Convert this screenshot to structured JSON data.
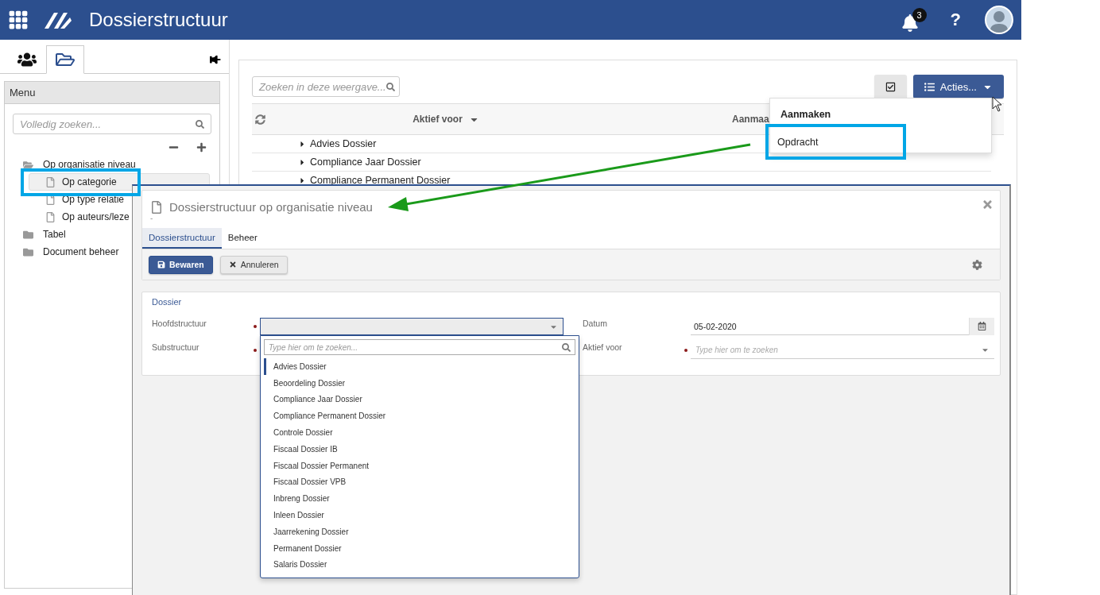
{
  "header": {
    "title": "Dossierstructuur",
    "notification_count": "3",
    "help": "?"
  },
  "sidebar": {
    "tabs": [
      {
        "kind": "people",
        "selected": false
      },
      {
        "kind": "folder",
        "selected": true
      }
    ],
    "menu_title": "Menu",
    "search_placeholder": "Volledig zoeken...",
    "tree": [
      {
        "label": "Op organisatie niveau",
        "expanded": true,
        "children": [
          {
            "label": "Op categorie",
            "selected": true
          },
          {
            "label": "Op type relatie",
            "selected": false
          },
          {
            "label": "Op auteurs/leze",
            "selected": false
          }
        ]
      },
      {
        "label": "Tabel",
        "expanded": false
      },
      {
        "label": "Document beheer",
        "expanded": false
      }
    ]
  },
  "view": {
    "search_placeholder": "Zoeken in deze weergave...",
    "actions_label": "Acties...",
    "columns": [
      {
        "label": "Aktief voor",
        "sorted": true
      },
      {
        "label": "Aanmaa"
      }
    ],
    "rows": [
      "Advies Dossier",
      "Compliance Jaar Dossier",
      "Compliance Permanent Dossier"
    ]
  },
  "actions_menu": {
    "header": "Aanmaken",
    "items": [
      "Opdracht"
    ]
  },
  "dialog": {
    "title": "Dossierstructuur op organisatie niveau",
    "subtitle": "-",
    "tabs": [
      {
        "label": "Dossierstructuur",
        "selected": true
      },
      {
        "label": "Beheer",
        "selected": false
      }
    ],
    "buttons": [
      {
        "label": "Bewaren",
        "kind": "primary"
      },
      {
        "label": "Annuleren",
        "kind": "secondary"
      }
    ],
    "section": "Dossier",
    "fields": [
      {
        "label": "Hoofdstructuur",
        "required": true,
        "kind": "select",
        "open": true
      },
      {
        "label": "Datum",
        "kind": "date",
        "value": "05-02-2020"
      },
      {
        "label": "Substructuur",
        "required": true,
        "kind": "hidden"
      },
      {
        "label": "Aktief voor",
        "required": true,
        "kind": "select",
        "open": false,
        "placeholder": "Type hier om te zoeken"
      }
    ],
    "dropdown": {
      "placeholder": "Type hier om te zoeken...",
      "options": [
        {
          "label": "Advies Dossier",
          "selected": true
        },
        {
          "label": "Beoordeling Dossier",
          "selected": false
        },
        {
          "label": "Compliance Jaar Dossier",
          "selected": false
        },
        {
          "label": "Compliance Permanent Dossier",
          "selected": false
        },
        {
          "label": "Controle Dossier",
          "selected": false
        },
        {
          "label": "Fiscaal Dossier IB",
          "selected": false
        },
        {
          "label": "Fiscaal Dossier Permanent",
          "selected": false
        },
        {
          "label": "Fiscaal Dossier VPB",
          "selected": false
        },
        {
          "label": "Inbreng Dossier",
          "selected": false
        },
        {
          "label": "Inleen Dossier",
          "selected": false
        },
        {
          "label": "Jaarrekening Dossier",
          "selected": false
        },
        {
          "label": "Permanent Dossier",
          "selected": false
        },
        {
          "label": "Salaris Dossier",
          "selected": false
        }
      ]
    }
  }
}
